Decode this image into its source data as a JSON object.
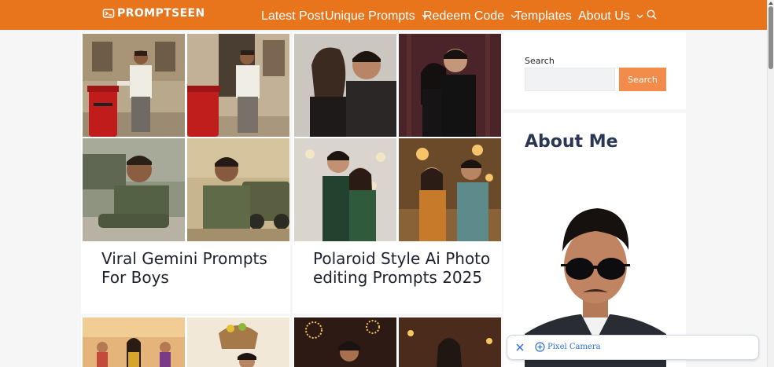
{
  "header": {
    "logo_text": "PROMPTSEEN",
    "nav": [
      {
        "label": "Latest Post",
        "dropdown": false
      },
      {
        "label": "Unique Prompts",
        "dropdown": true
      },
      {
        "label": "Redeem Code",
        "dropdown": true
      },
      {
        "label": "Templates",
        "dropdown": false
      },
      {
        "label": "About Us",
        "dropdown": true
      }
    ],
    "search_icon": "search-icon"
  },
  "posts": [
    {
      "title": "Viral Gemini Prompts For Boys"
    },
    {
      "title": "Polaroid Style Ai Photo editing Prompts 2025"
    }
  ],
  "sidebar": {
    "search_label": "Search",
    "search_placeholder": "",
    "search_button": "Search",
    "about_title": "About Me"
  },
  "pixel_bar": {
    "label": "Pixel Camera",
    "close_icon": "close-icon",
    "icon": "plus-circle-icon"
  },
  "colors": {
    "brand": "#e8741c",
    "button": "#f38b4a",
    "link": "#2c6fd6"
  }
}
